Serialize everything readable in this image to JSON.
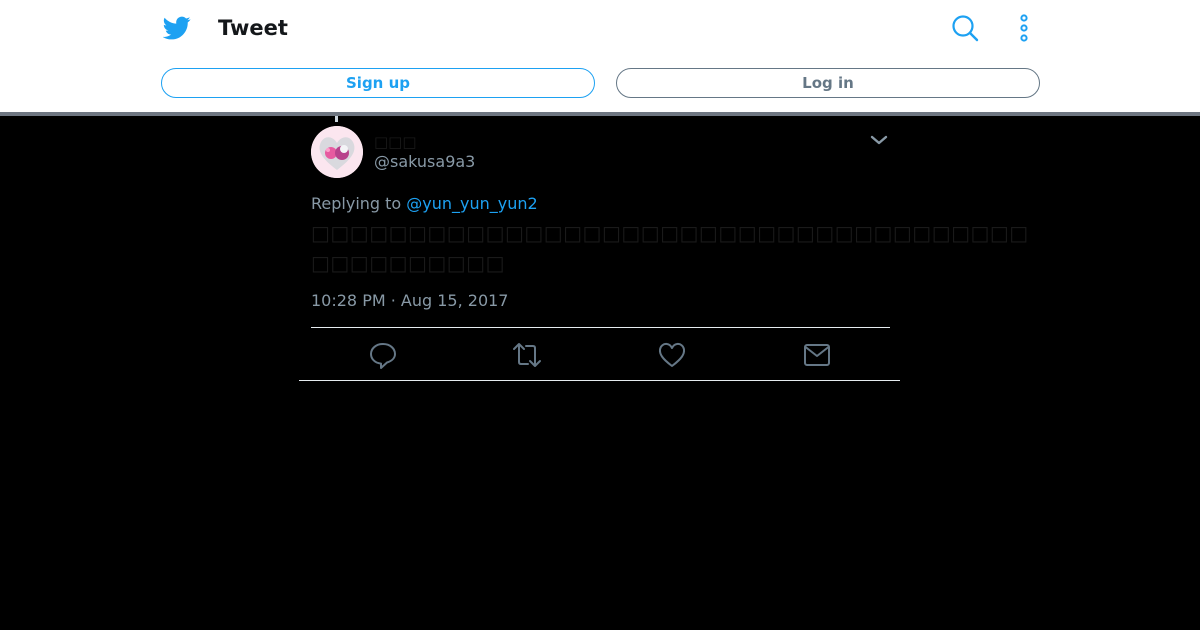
{
  "header": {
    "title": "Tweet",
    "logo_icon": "twitter-bird-icon",
    "search_icon": "search-icon",
    "more_icon": "more-vertical-icon",
    "signup_label": "Sign up",
    "login_label": "Log in"
  },
  "tweet": {
    "display_name": "□□□",
    "handle": "@sakusa9a3",
    "replying_prefix": "Replying to",
    "replying_to": "@yun_yun_yun2",
    "text_line1": "□□□□□□□□□□□□□□□□□□□□□□□□□□□□□□□□□□□□□",
    "text_line2": "□□□□□□□□□□",
    "timestamp": "10:28 PM · Aug 15, 2017"
  },
  "actions": {
    "reply_icon": "reply-icon",
    "retweet_icon": "retweet-icon",
    "like_icon": "heart-icon",
    "dm_icon": "envelope-icon"
  },
  "colors": {
    "brand": "#1da1f2",
    "muted": "#657786",
    "background": "#000000",
    "header_bg": "#ffffff"
  }
}
